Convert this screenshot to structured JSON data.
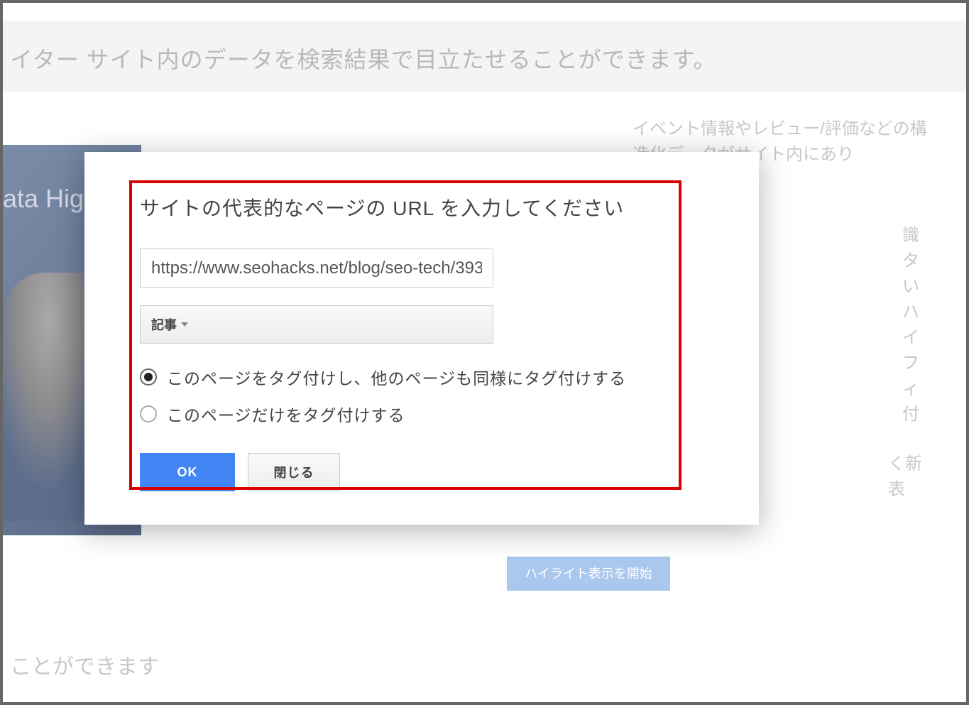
{
  "background": {
    "header_text": "イター サイト内のデータを検索結果で目立たせることができます。",
    "video_label": "ata Hig",
    "right_text": "イベント情報やレビュー/評価などの構造化データがサイト内にあり",
    "right_partial_text": "識 タ い ハイ フィ 付",
    "right_partial_text2": "く新 表",
    "highlight_button_label": "ハイライト表示を開始",
    "bottom_text": "ことができます"
  },
  "modal": {
    "title": "サイトの代表的なページの URL を入力してください",
    "url_value": "https://www.seohacks.net/blog/seo-tech/393",
    "select_label": "記事",
    "radio_options": [
      {
        "label": "このページをタグ付けし、他のページも同様にタグ付けする",
        "selected": true
      },
      {
        "label": "このページだけをタグ付けする",
        "selected": false
      }
    ],
    "ok_label": "OK",
    "close_label": "閉じる"
  }
}
